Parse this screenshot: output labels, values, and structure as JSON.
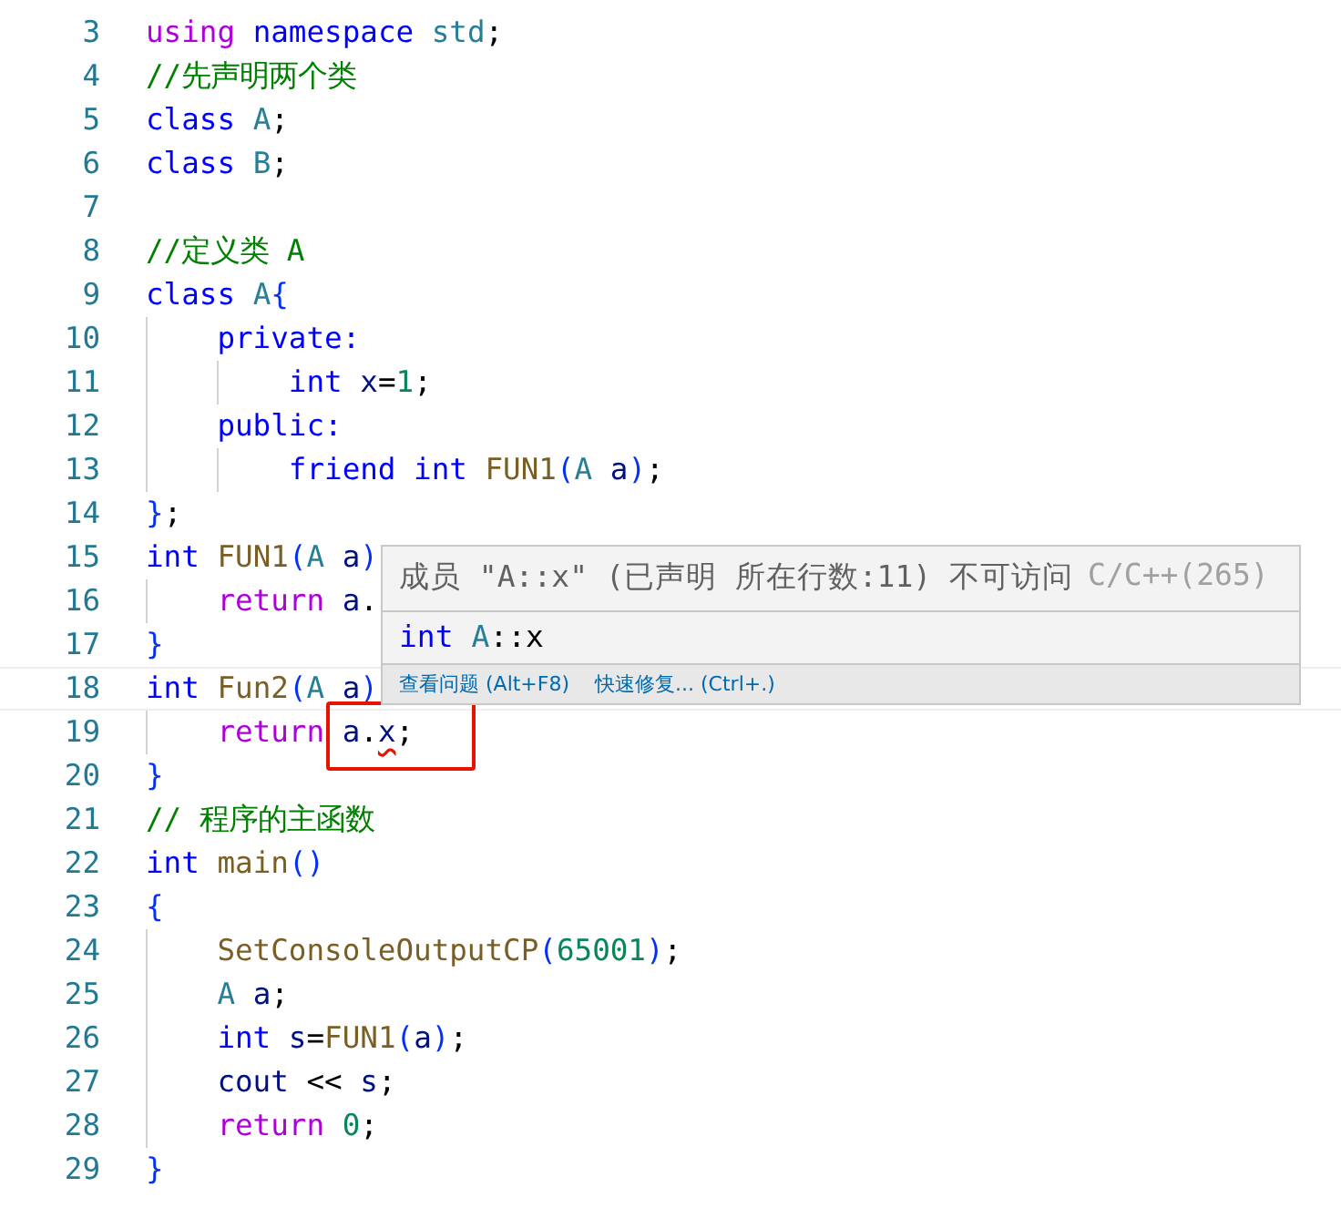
{
  "editor": {
    "lines": [
      {
        "number": "3",
        "tokens": [
          {
            "t": "using ",
            "color": "#af00db"
          },
          {
            "t": "namespace ",
            "color": "#0000ff"
          },
          {
            "t": "std",
            "color": "#267f99"
          },
          {
            "t": ";",
            "color": "#000000"
          }
        ]
      },
      {
        "number": "4",
        "tokens": [
          {
            "t": "//先声明两个类",
            "color": "#008000"
          }
        ]
      },
      {
        "number": "5",
        "tokens": [
          {
            "t": "class ",
            "color": "#0000ff"
          },
          {
            "t": "A",
            "color": "#267f99"
          },
          {
            "t": ";",
            "color": "#000000"
          }
        ]
      },
      {
        "number": "6",
        "tokens": [
          {
            "t": "class ",
            "color": "#0000ff"
          },
          {
            "t": "B",
            "color": "#267f99"
          },
          {
            "t": ";",
            "color": "#000000"
          }
        ]
      },
      {
        "number": "7"
      },
      {
        "number": "8",
        "tokens": [
          {
            "t": "//定义类 A",
            "color": "#008000"
          }
        ]
      },
      {
        "number": "9",
        "tokens": [
          {
            "t": "class ",
            "color": "#0000ff"
          },
          {
            "t": "A",
            "color": "#267f99"
          },
          {
            "t": "{",
            "color": "#0431fa"
          }
        ]
      },
      {
        "number": "10",
        "tokens": [
          {
            "t": "    private:",
            "color": "#0000ff"
          }
        ]
      },
      {
        "number": "11",
        "tokens": [
          {
            "t": "        int ",
            "color": "#0000ff"
          },
          {
            "t": "x",
            "color": "#001080"
          },
          {
            "t": "=",
            "color": "#000000"
          },
          {
            "t": "1",
            "color": "#098658"
          },
          {
            "t": ";",
            "color": "#000000"
          }
        ]
      },
      {
        "number": "12",
        "tokens": [
          {
            "t": "    public:",
            "color": "#0000ff"
          }
        ]
      },
      {
        "number": "13",
        "tokens": [
          {
            "t": "        friend int ",
            "color": "#0000ff"
          },
          {
            "t": "FUN1",
            "color": "#795e26"
          },
          {
            "t": "(",
            "color": "#0431fa"
          },
          {
            "t": "A ",
            "color": "#267f99"
          },
          {
            "t": "a",
            "color": "#001080"
          },
          {
            "t": ")",
            "color": "#0431fa"
          },
          {
            "t": ";",
            "color": "#000000"
          }
        ]
      },
      {
        "number": "14",
        "tokens": [
          {
            "t": "}",
            "color": "#0431fa"
          },
          {
            "t": ";",
            "color": "#000000"
          }
        ]
      },
      {
        "number": "15",
        "tokens": [
          {
            "t": "int ",
            "color": "#0000ff"
          },
          {
            "t": "FUN1",
            "color": "#795e26"
          },
          {
            "t": "(",
            "color": "#0431fa"
          },
          {
            "t": "A ",
            "color": "#267f99"
          },
          {
            "t": "a",
            "color": "#001080"
          },
          {
            "t": ")",
            "color": "#0431fa"
          }
        ]
      },
      {
        "number": "16",
        "tokens": [
          {
            "t": "    return ",
            "color": "#af00db"
          },
          {
            "t": "a",
            "color": "#001080"
          },
          {
            "t": ".",
            "color": "#000000"
          }
        ]
      },
      {
        "number": "17",
        "tokens": [
          {
            "t": "}",
            "color": "#0431fa"
          }
        ]
      },
      {
        "number": "18",
        "current": true,
        "tokens": [
          {
            "t": "int ",
            "color": "#0000ff"
          },
          {
            "t": "Fun2",
            "color": "#795e26"
          },
          {
            "t": "(",
            "color": "#0431fa"
          },
          {
            "t": "A ",
            "color": "#267f99"
          },
          {
            "t": "a",
            "color": "#001080"
          },
          {
            "t": ")",
            "color": "#0431fa"
          }
        ]
      },
      {
        "number": "19",
        "tokens": [
          {
            "t": "    return ",
            "color": "#af00db"
          },
          {
            "t": "a",
            "color": "#001080",
            "boxed": true
          },
          {
            "t": ".",
            "color": "#000000",
            "boxed": true
          },
          {
            "t": "x",
            "color": "#001080",
            "boxed": true,
            "error": true
          },
          {
            "t": ";",
            "color": "#000000",
            "boxed": true
          }
        ]
      },
      {
        "number": "20",
        "tokens": [
          {
            "t": "}",
            "color": "#0431fa"
          }
        ]
      },
      {
        "number": "21",
        "tokens": [
          {
            "t": "// 程序的主函数",
            "color": "#008000"
          }
        ]
      },
      {
        "number": "22",
        "tokens": [
          {
            "t": "int ",
            "color": "#0000ff"
          },
          {
            "t": "main",
            "color": "#795e26"
          },
          {
            "t": "()",
            "color": "#0431fa"
          }
        ]
      },
      {
        "number": "23",
        "tokens": [
          {
            "t": "{",
            "color": "#0431fa"
          }
        ]
      },
      {
        "number": "24",
        "tokens": [
          {
            "t": "    SetConsoleOutputCP",
            "color": "#795e26"
          },
          {
            "t": "(",
            "color": "#0431fa"
          },
          {
            "t": "65001",
            "color": "#098658"
          },
          {
            "t": ")",
            "color": "#0431fa"
          },
          {
            "t": ";",
            "color": "#000000"
          }
        ]
      },
      {
        "number": "25",
        "tokens": [
          {
            "t": "    A ",
            "color": "#267f99"
          },
          {
            "t": "a",
            "color": "#001080"
          },
          {
            "t": ";",
            "color": "#000000"
          }
        ]
      },
      {
        "number": "26",
        "tokens": [
          {
            "t": "    int ",
            "color": "#0000ff"
          },
          {
            "t": "s",
            "color": "#001080"
          },
          {
            "t": "=",
            "color": "#000000"
          },
          {
            "t": "FUN1",
            "color": "#795e26"
          },
          {
            "t": "(",
            "color": "#0431fa"
          },
          {
            "t": "a",
            "color": "#001080"
          },
          {
            "t": ")",
            "color": "#0431fa"
          },
          {
            "t": ";",
            "color": "#000000"
          }
        ]
      },
      {
        "number": "27",
        "tokens": [
          {
            "t": "    cout ",
            "color": "#001080"
          },
          {
            "t": "<< ",
            "color": "#000000"
          },
          {
            "t": "s",
            "color": "#001080"
          },
          {
            "t": ";",
            "color": "#000000"
          }
        ]
      },
      {
        "number": "28",
        "tokens": [
          {
            "t": "    return ",
            "color": "#af00db"
          },
          {
            "t": "0",
            "color": "#098658"
          },
          {
            "t": ";",
            "color": "#000000"
          }
        ]
      },
      {
        "number": "29",
        "tokens": [
          {
            "t": "}",
            "color": "#0431fa"
          }
        ]
      }
    ]
  },
  "hover": {
    "message": "成员 \"A::x\" (已声明 所在行数:11) 不可访问",
    "source": "C/C++(265)",
    "signature": [
      {
        "t": "int ",
        "color": "#0000ff"
      },
      {
        "t": "A",
        "color": "#267f99"
      },
      {
        "t": "::x",
        "color": "#000000"
      }
    ],
    "actions": [
      "查看问题 (Alt+F8)",
      "快速修复... (Ctrl+.)"
    ]
  }
}
